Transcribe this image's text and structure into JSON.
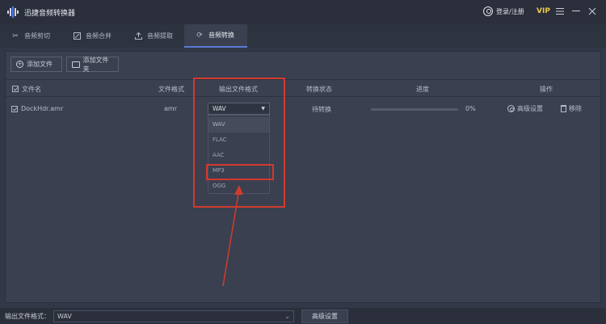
{
  "app": {
    "title": "迅捷音频转换器"
  },
  "header": {
    "login_label": "登录/注册",
    "vip_label": "VIP"
  },
  "tabs": [
    {
      "label": "音频剪切",
      "icon": "scissors-icon"
    },
    {
      "label": "音频合并",
      "icon": "merge-icon"
    },
    {
      "label": "音频提取",
      "icon": "extract-icon"
    },
    {
      "label": "音频转换",
      "icon": "convert-icon",
      "active": true
    }
  ],
  "toolbar": {
    "add_file_label": "添加文件",
    "add_folder_label": "添加文件夹"
  },
  "table": {
    "headers": {
      "filename": "文件名",
      "format": "文件格式",
      "output_format": "输出文件格式",
      "status": "转换状态",
      "progress": "进度",
      "actions": "操作"
    },
    "rows": [
      {
        "filename": "DockHdr.amr",
        "format": "amr",
        "output_format": "WAV",
        "status": "待转换",
        "progress_text": "0%",
        "progress_value": 0,
        "advanced_label": "高级设置",
        "remove_label": "移除"
      }
    ]
  },
  "dropdown": {
    "options": [
      "WAV",
      "FLAC",
      "AAC",
      "MP3",
      "OGG"
    ],
    "selected": "WAV"
  },
  "bottom": {
    "label": "输出文件格式：",
    "format_value": "WAV",
    "advanced_button": "高级设置"
  },
  "colors": {
    "accent": "#5b7bd5",
    "annotation": "#d23a2f",
    "vip": "#f2c94c"
  }
}
